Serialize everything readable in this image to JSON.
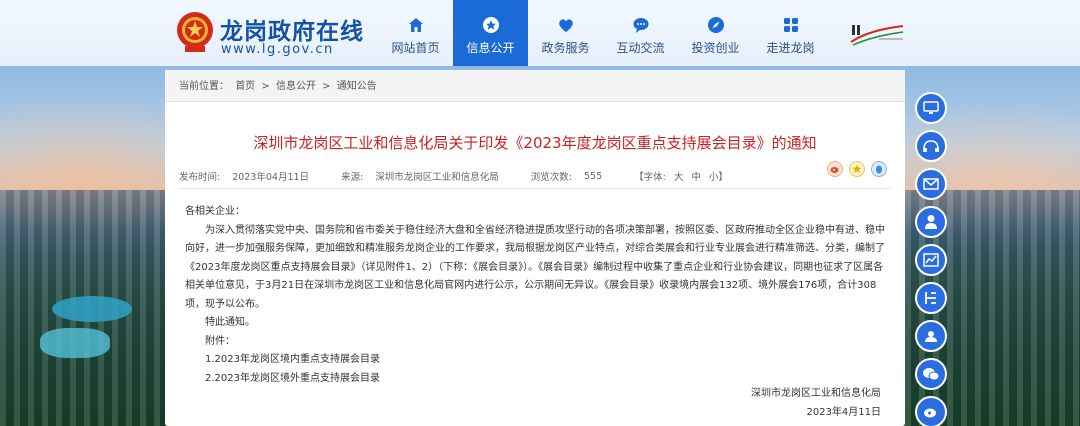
{
  "site": {
    "title": "龙岗政府在线",
    "url": "www.lg.gov.cn"
  },
  "nav": [
    {
      "label": "网站首页",
      "icon": "home-icon",
      "active": false
    },
    {
      "label": "信息公开",
      "icon": "star-badge-icon",
      "active": true
    },
    {
      "label": "政务服务",
      "icon": "heart-icon",
      "active": false
    },
    {
      "label": "互动交流",
      "icon": "chat-icon",
      "active": false
    },
    {
      "label": "投资创业",
      "icon": "compass-icon",
      "active": false
    },
    {
      "label": "走进龙岗",
      "icon": "grid-icon",
      "active": false
    }
  ],
  "breadcrumb": {
    "prefix": "当前位置：",
    "items": [
      "首页",
      "信息公开",
      "通知公告"
    ],
    "sep": ">"
  },
  "article": {
    "title": "深圳市龙岗区工业和信息化局关于印发《2023年度龙岗区重点支持展会目录》的通知",
    "meta": {
      "date_label": "发布时间:",
      "date": "2023年04月11日",
      "source_label": "来源:",
      "source": "深圳市龙岗区工业和信息化局",
      "views_label": "浏览次数:",
      "views": "555",
      "font_label": "【字体:",
      "font_large": "大",
      "font_medium": "中",
      "font_small": "小】"
    },
    "greeting": "各相关企业：",
    "paragraph1": "为深入贯彻落实党中央、国务院和省市委关于稳住经济大盘和全省经济稳进提质攻坚行动的各项决策部署，按照区委、区政府推动全区企业稳中有进、稳中向好，进一步加强服务保障，更加细致和精准服务龙岗企业的工作要求，我局根据龙岗区产业特点，对综合类展会和行业专业展会进行精准筛选、分类，编制了《2023年度龙岗区重点支持展会目录》（详见附件1、2）（下称：《展会目录》）。《展会目录》编制过程中收集了重点企业和行业协会建议，同期也征求了区属各相关单位意见，于3月21日在深圳市龙岗区工业和信息化局官网内进行公示，公示期间无异议。《展会目录》收录境内展会132项、境外展会176项，合计308项，现予以公布。",
    "closing": "特此通知。",
    "attach_label": "附件：",
    "attachments": [
      "1.2023年龙岗区境内重点支持展会目录",
      "2.2023年龙岗区境外重点支持展会目录"
    ],
    "signature": "深圳市龙岗区工业和信息化局",
    "sign_date": "2023年4月11日"
  },
  "colors": {
    "brand": "#1452a8",
    "nav_active": "#1a6ad8",
    "title_red": "#cc2222"
  }
}
